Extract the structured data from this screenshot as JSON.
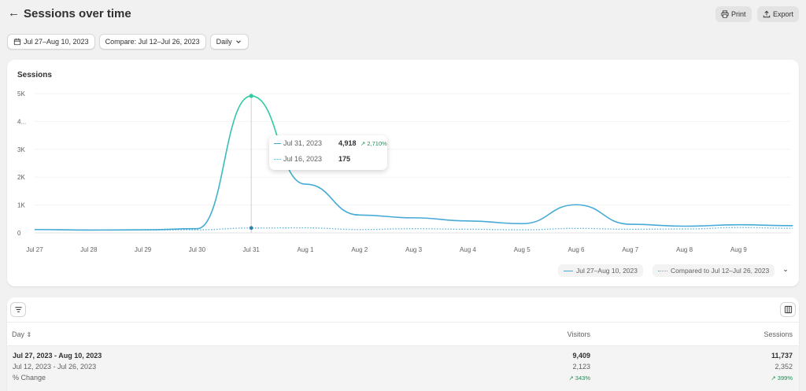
{
  "header": {
    "title": "Sessions over time",
    "print_label": "Print",
    "export_label": "Export"
  },
  "filters": {
    "date_range": "Jul 27–Aug 10, 2023",
    "compare": "Compare: Jul 12–Jul 26, 2023",
    "granularity": "Daily"
  },
  "colors": {
    "primary": "#47a9d6",
    "highlight": "#2fcca2",
    "comparison": "#5bb3d8",
    "positive": "#1a8f50"
  },
  "chart_data": {
    "type": "line",
    "title": "Sessions",
    "x": [
      "Jul 27",
      "Jul 28",
      "Jul 29",
      "Jul 30",
      "Jul 31",
      "Aug 1",
      "Aug 2",
      "Aug 3",
      "Aug 4",
      "Aug 5",
      "Aug 6",
      "Aug 7",
      "Aug 8",
      "Aug 9",
      "Aug 10"
    ],
    "x_tick_labels": [
      "Jul 27",
      "Jul 28",
      "Jul 29",
      "Jul 30",
      "Jul 31",
      "Aug 1",
      "Aug 2",
      "Aug 3",
      "Aug 4",
      "Aug 5",
      "Aug 6",
      "Aug 7",
      "Aug 8",
      "Aug 9"
    ],
    "y_tick_labels": [
      "0",
      "1K",
      "2K",
      "3K",
      "4...",
      "5K"
    ],
    "ylim": [
      0,
      5000
    ],
    "series": [
      {
        "name": "Jul 27–Aug 10, 2023",
        "values": [
          120,
          100,
          110,
          150,
          4918,
          1750,
          640,
          540,
          430,
          330,
          1010,
          310,
          240,
          290,
          260
        ]
      },
      {
        "name": "Compared to Jul 12–Jul 26, 2023",
        "values": [
          120,
          105,
          100,
          110,
          175,
          180,
          120,
          150,
          130,
          110,
          160,
          130,
          140,
          190,
          165
        ]
      }
    ],
    "tooltip": {
      "primary": {
        "date": "Jul 31, 2023",
        "value": "4,918",
        "change": "↗ 2,710%"
      },
      "compare": {
        "date": "Jul 16, 2023",
        "value": "175"
      }
    }
  },
  "table": {
    "columns": {
      "day": "Day",
      "visitors": "Visitors",
      "sessions": "Sessions"
    },
    "rows": [
      {
        "label": "Jul 27, 2023 - Aug 10, 2023",
        "visitors": "9,409",
        "sessions": "11,737"
      },
      {
        "label": "Jul 12, 2023 - Jul 26, 2023",
        "visitors": "2,123",
        "sessions": "2,352"
      },
      {
        "label": "% Change",
        "visitors": "↗ 343%",
        "sessions": "↗ 399%"
      }
    ]
  }
}
